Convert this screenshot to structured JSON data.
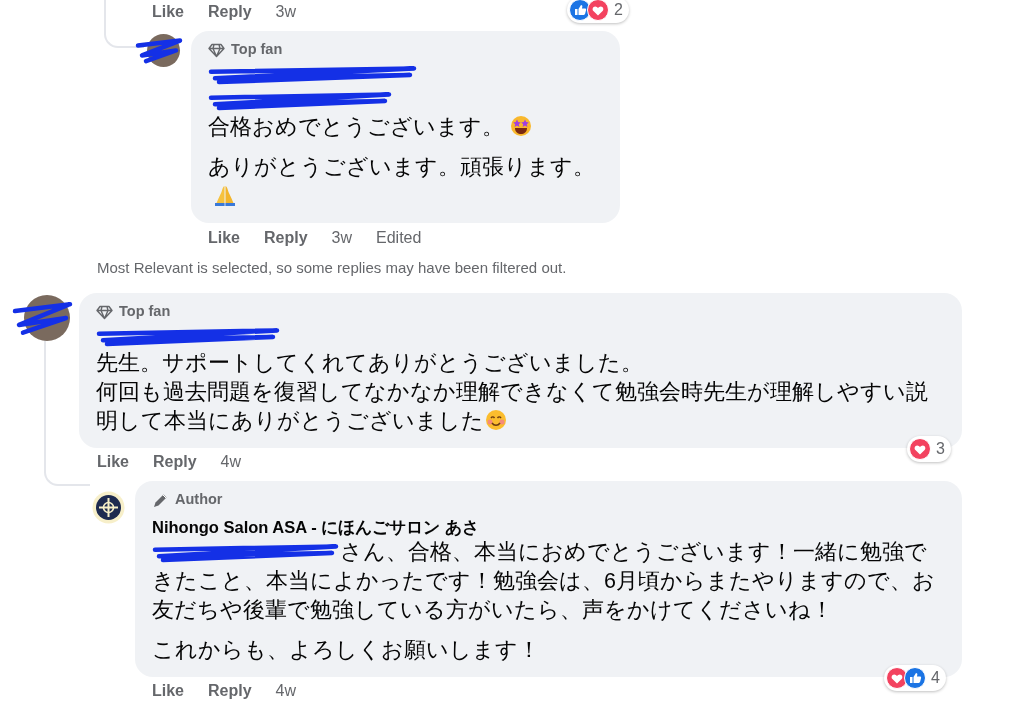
{
  "previous_comment": {
    "actions": {
      "like": "Like",
      "reply": "Reply",
      "time": "3w"
    },
    "reactions": {
      "types": [
        {
          "kind": "like"
        },
        {
          "kind": "heart"
        }
      ],
      "count": "2"
    }
  },
  "reply_thread": [
    {
      "badge": {
        "kind": "top_fan",
        "label": "Top fan"
      },
      "avatar": {
        "kind": "photo"
      },
      "name_redactions": [
        {
          "kind": "scribble"
        },
        {
          "kind": "scribble"
        }
      ],
      "paragraphs": [
        {
          "lines": [
            {
              "text": "合格おめでとうございます。",
              "end_icon": {
                "kind": "star_eyes_face"
              }
            }
          ]
        },
        {
          "lines": [
            {
              "text": "ありがとうございます。頑張ります。",
              "end_icon": {
                "kind": "praying_hands"
              }
            }
          ]
        }
      ],
      "actions": {
        "like": "Like",
        "reply": "Reply",
        "time": "3w",
        "edited": "Edited"
      }
    }
  ],
  "filter_notice": "Most Relevant is selected, so some replies may have been filtered out.",
  "comments": [
    {
      "badge": {
        "kind": "top_fan",
        "label": "Top fan"
      },
      "avatar": {
        "kind": "photo"
      },
      "name_redactions": [
        {
          "kind": "scribble"
        }
      ],
      "paragraphs": [
        {
          "lines": [
            {
              "text": "先生。サポートしてくれてありがとうございました。"
            },
            {
              "text": "何回も過去問題を復習してなかなか理解できなくて勉強会時先生が理解しやすい説明して本当にありがとうございました",
              "end_icon": {
                "kind": "smiling_face"
              }
            }
          ]
        }
      ],
      "actions": {
        "like": "Like",
        "reply": "Reply",
        "time": "4w"
      },
      "reactions": {
        "types": [
          {
            "kind": "heart"
          }
        ],
        "count": "3"
      },
      "replies": [
        {
          "badge": {
            "kind": "author",
            "label": "Author"
          },
          "avatar": {
            "kind": "logo"
          },
          "name": "Nihongo Salon ASA - にほんごサロン あさ",
          "paragraphs": [
            {
              "lines": [
                {
                  "mention": {
                    "kind": "scribble"
                  },
                  "text": "さん、合格、本当におめでとうございます！一緒に勉強できたこと、本当によかったです！勉強会は、6月頃からまたやりますので、お友だちや後輩で勉強している方がいたら、声をかけてくださいね！"
                }
              ]
            },
            {
              "lines": [
                {
                  "text": "これからも、よろしくお願いします！"
                }
              ]
            }
          ],
          "actions": {
            "like": "Like",
            "reply": "Reply",
            "time": "4w"
          },
          "reactions": {
            "types": [
              {
                "kind": "heart"
              },
              {
                "kind": "like"
              }
            ],
            "count": "4"
          }
        }
      ]
    }
  ]
}
